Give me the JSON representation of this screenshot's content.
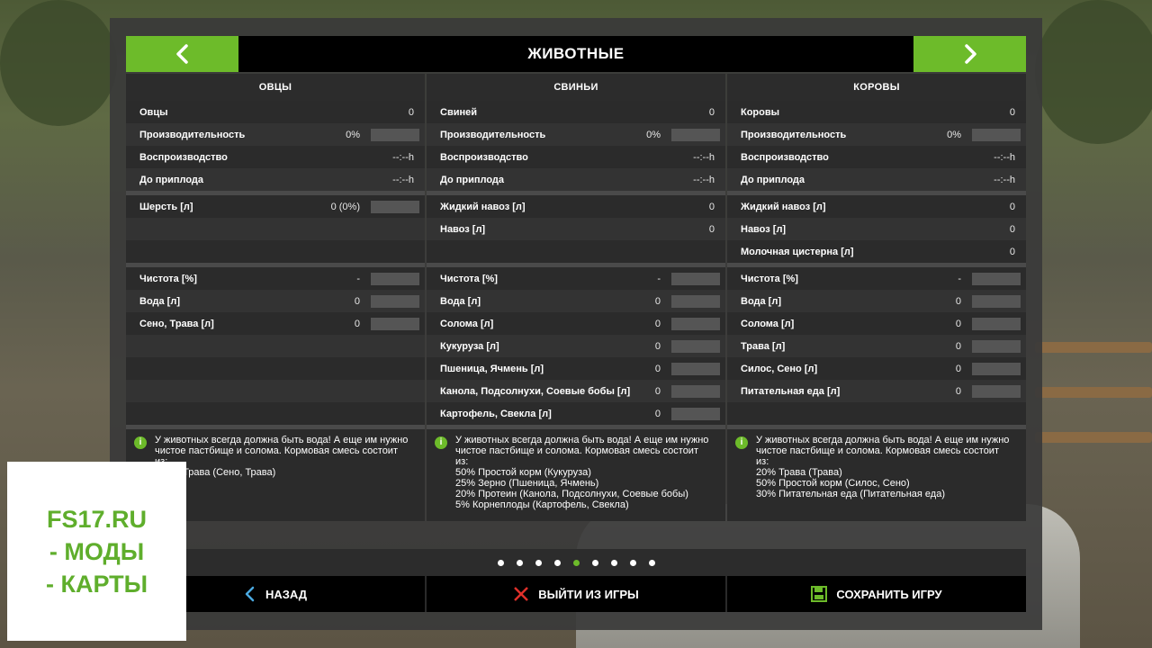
{
  "header": {
    "title": "ЖИВОТНЫЕ"
  },
  "icons": {
    "prev": "chevron-left-icon",
    "next": "chevron-right-icon",
    "info": "info-icon",
    "back": "chevron-left-icon",
    "quit": "close-icon",
    "save": "floppy-disk-icon"
  },
  "colors": {
    "accent": "#6dbb2a",
    "header_bg": "#000000",
    "quit_icon": "#e0302a",
    "back_icon": "#4aa8e0"
  },
  "columns": [
    {
      "title": "ОВЦЫ",
      "stats": [
        {
          "label": "Овцы",
          "value": "0",
          "bar": false
        },
        {
          "label": "Производительность",
          "value": "0%",
          "bar": true
        },
        {
          "label": "Воспроизводство",
          "value": "--:--h",
          "bar": false
        },
        {
          "label": "До приплода",
          "value": "--:--h",
          "bar": false
        }
      ],
      "products": [
        {
          "label": "Шерсть [л]",
          "value": "0 (0%)",
          "bar": true
        },
        {
          "label": "",
          "value": "",
          "bar": false
        },
        {
          "label": "",
          "value": "",
          "bar": false
        }
      ],
      "needs": [
        {
          "label": "Чистота [%]",
          "value": "-",
          "bar": true
        },
        {
          "label": "Вода [л]",
          "value": "0",
          "bar": true
        },
        {
          "label": "Сено, Трава [л]",
          "value": "0",
          "bar": true
        },
        {
          "label": "",
          "value": "",
          "bar": false
        },
        {
          "label": "",
          "value": "",
          "bar": false
        },
        {
          "label": "",
          "value": "",
          "bar": false
        },
        {
          "label": "",
          "value": "",
          "bar": false
        }
      ],
      "info": "У животных всегда должна быть вода! А еще им нужно\nчистое пастбище и солома. Кормовая смесь состоит\nиз:\n100% Трава (Сено, Трава)"
    },
    {
      "title": "СВИНЬИ",
      "stats": [
        {
          "label": "Свиней",
          "value": "0",
          "bar": false
        },
        {
          "label": "Производительность",
          "value": "0%",
          "bar": true
        },
        {
          "label": "Воспроизводство",
          "value": "--:--h",
          "bar": false
        },
        {
          "label": "До приплода",
          "value": "--:--h",
          "bar": false
        }
      ],
      "products": [
        {
          "label": "Жидкий навоз [л]",
          "value": "0",
          "bar": false
        },
        {
          "label": "Навоз [л]",
          "value": "0",
          "bar": false
        },
        {
          "label": "",
          "value": "",
          "bar": false
        }
      ],
      "needs": [
        {
          "label": "Чистота [%]",
          "value": "-",
          "bar": true
        },
        {
          "label": "Вода [л]",
          "value": "0",
          "bar": true
        },
        {
          "label": "Солома [л]",
          "value": "0",
          "bar": true
        },
        {
          "label": "Кукуруза [л]",
          "value": "0",
          "bar": true
        },
        {
          "label": "Пшеница, Ячмень [л]",
          "value": "0",
          "bar": true
        },
        {
          "label": "Канола, Подсолнухи, Соевые бобы [л]",
          "value": "0",
          "bar": true
        },
        {
          "label": "Картофель, Свекла [л]",
          "value": "0",
          "bar": true
        }
      ],
      "info": "У животных всегда должна быть вода! А еще им нужно\nчистое пастбище и солома. Кормовая смесь состоит\nиз:\n50% Простой корм (Кукуруза)\n25% Зерно (Пшеница, Ячмень)\n20% Протеин (Канола, Подсолнухи, Соевые бобы)\n5% Корнеплоды (Картофель, Свекла)"
    },
    {
      "title": "КОРОВЫ",
      "stats": [
        {
          "label": "Коровы",
          "value": "0",
          "bar": false
        },
        {
          "label": "Производительность",
          "value": "0%",
          "bar": true
        },
        {
          "label": "Воспроизводство",
          "value": "--:--h",
          "bar": false
        },
        {
          "label": "До приплода",
          "value": "--:--h",
          "bar": false
        }
      ],
      "products": [
        {
          "label": "Жидкий навоз [л]",
          "value": "0",
          "bar": false
        },
        {
          "label": "Навоз [л]",
          "value": "0",
          "bar": false
        },
        {
          "label": "Молочная цистерна [л]",
          "value": "0",
          "bar": false
        }
      ],
      "needs": [
        {
          "label": "Чистота [%]",
          "value": "-",
          "bar": true
        },
        {
          "label": "Вода [л]",
          "value": "0",
          "bar": true
        },
        {
          "label": "Солома [л]",
          "value": "0",
          "bar": true
        },
        {
          "label": "Трава [л]",
          "value": "0",
          "bar": true
        },
        {
          "label": "Силос, Сено [л]",
          "value": "0",
          "bar": true
        },
        {
          "label": "Питательная еда [л]",
          "value": "0",
          "bar": true
        },
        {
          "label": "",
          "value": "",
          "bar": false
        }
      ],
      "info": "У животных всегда должна быть вода! А еще им нужно\nчистое пастбище и солома. Кормовая смесь состоит\nиз:\n20% Трава (Трава)\n50% Простой корм (Силос, Сено)\n30% Питательная еда (Питательная еда)"
    }
  ],
  "pager": {
    "count": 9,
    "active_index": 4
  },
  "footer": {
    "back_label": "НАЗАД",
    "quit_label": "ВЫЙТИ ИЗ ИГРЫ",
    "save_label": "СОХРАНИТЬ ИГРУ"
  },
  "watermark": {
    "line1": "FS17.RU",
    "line2": "- МОДЫ",
    "line3": "- КАРТЫ"
  }
}
